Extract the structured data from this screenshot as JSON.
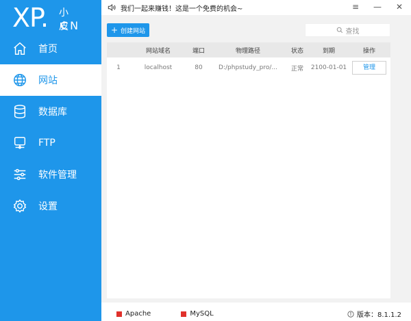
{
  "logo": {
    "main": "XP.",
    "small": "小皮",
    "cn": "CN"
  },
  "nav": [
    {
      "label": "首页",
      "icon": "home-icon",
      "active": false
    },
    {
      "label": "网站",
      "icon": "globe-icon",
      "active": true
    },
    {
      "label": "数据库",
      "icon": "database-icon",
      "active": false
    },
    {
      "label": "FTP",
      "icon": "ftp-icon",
      "active": false
    },
    {
      "label": "软件管理",
      "icon": "sliders-icon",
      "active": false
    },
    {
      "label": "设置",
      "icon": "gear-icon",
      "active": false
    }
  ],
  "topbar": {
    "notice": "我们一起来赚钱！这是一个免费的机会~",
    "minimize": "—",
    "menu": "≡",
    "close": "✕"
  },
  "toolbar": {
    "create_label": "创建网站",
    "search_placeholder": "查找"
  },
  "table": {
    "headers": [
      "",
      "网站域名",
      "端口",
      "物理路径",
      "状态",
      "到期",
      "操作"
    ],
    "rows": [
      {
        "index": "1",
        "domain": "localhost",
        "port": "80",
        "path": "D:/phpstudy_pro/...",
        "status": "正常",
        "expire": "2100-01-01",
        "action": "管理"
      }
    ]
  },
  "footer": {
    "services": [
      {
        "name": "Apache",
        "status_color": "#e0312b"
      },
      {
        "name": "MySQL",
        "status_color": "#e0312b"
      }
    ],
    "version": "版本：8.1.1.2"
  },
  "colors": {
    "accent": "#1e96ea",
    "stopped": "#e0312b"
  }
}
